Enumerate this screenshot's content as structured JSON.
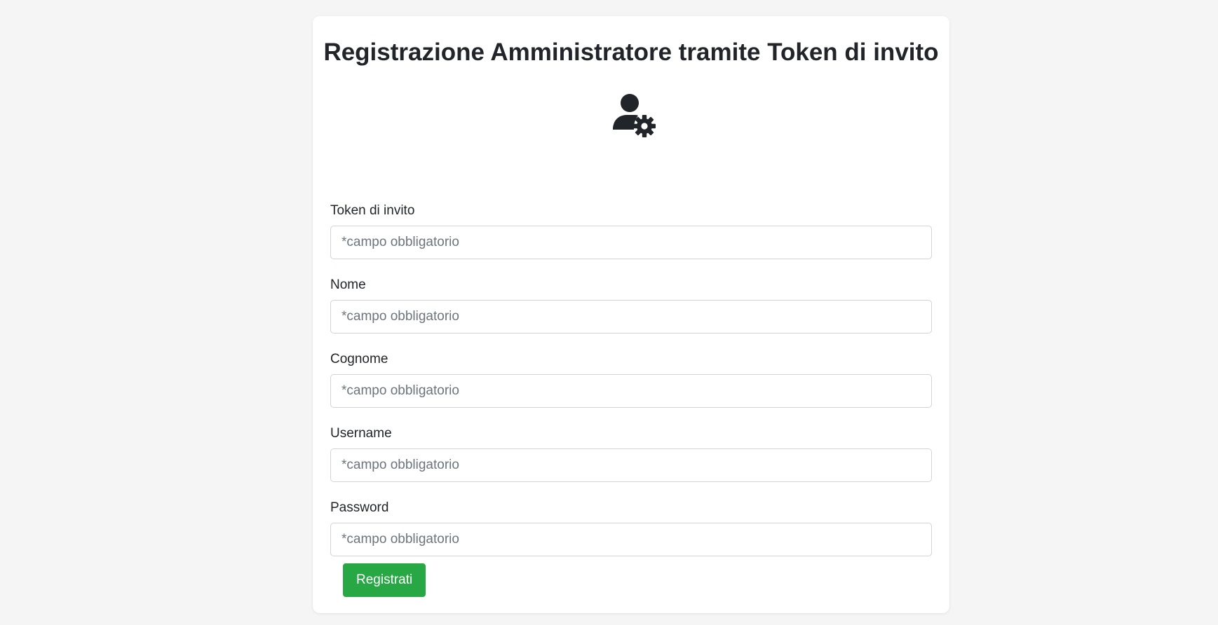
{
  "page": {
    "title": "Registrazione Amministratore tramite Token di invito",
    "icon": "user-gear-icon"
  },
  "form": {
    "fields": [
      {
        "label": "Token di invito",
        "placeholder": "*campo obbligatorio",
        "value": ""
      },
      {
        "label": "Nome",
        "placeholder": "*campo obbligatorio",
        "value": ""
      },
      {
        "label": "Cognome",
        "placeholder": "*campo obbligatorio",
        "value": ""
      },
      {
        "label": "Username",
        "placeholder": "*campo obbligatorio",
        "value": ""
      },
      {
        "label": "Password",
        "placeholder": "*campo obbligatorio",
        "value": ""
      }
    ],
    "submit_label": "Registrati"
  },
  "colors": {
    "background": "#f4f5f4",
    "card": "#ffffff",
    "text": "#212529",
    "placeholder": "#6c757d",
    "border": "#ced4da",
    "success": "#28a745"
  }
}
